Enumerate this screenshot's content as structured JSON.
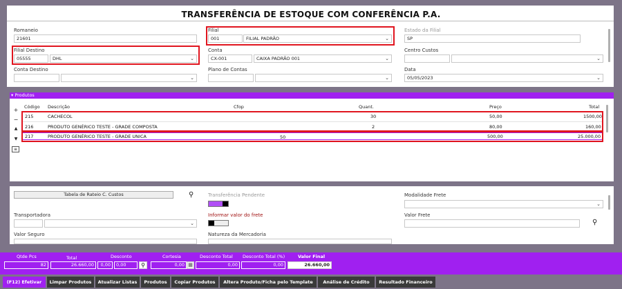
{
  "title": "TRANSFERÊNCIA DE ESTOQUE COM CONFERÊNCIA P.A.",
  "header": {
    "romaneio_label": "Romaneio",
    "romaneio_value": "21601",
    "filial_label": "Filial",
    "filial_code": "001",
    "filial_name": "FILIAL PADRÃO",
    "estado_label": "Estado da Filial",
    "estado_value": "SP",
    "filial_destino_label": "Filial Destino",
    "filial_destino_code": "05555",
    "filial_destino_name": "DHL",
    "conta_label": "Conta",
    "conta_code": "CX-001",
    "conta_name": "CAIXA PADRÃO 001",
    "centro_custos_label": "Centro Custos",
    "conta_destino_label": "Conta Destino",
    "plano_contas_label": "Plano de Contas",
    "data_label": "Data",
    "data_value": "05/05/2023"
  },
  "produtos": {
    "section_label": "Produtos",
    "columns": [
      "Código",
      "Descrição",
      "Cfop",
      "Quant.",
      "Preço",
      "Total"
    ],
    "rows": [
      {
        "codigo": "215",
        "descricao": "CACHECOL",
        "cfop": "",
        "quant": "30",
        "preco": "50,00",
        "total": "1500,00"
      },
      {
        "codigo": "216",
        "descricao": "PRODUTO GENÉRICO TESTE - GRADE COMPOSTA",
        "cfop": "",
        "quant": "2",
        "preco": "80,00",
        "total": "160,00"
      },
      {
        "codigo": "217",
        "descricao": "PRODUTO GENÉRICO TESTE - GRADE UNICA",
        "cfop": "",
        "quant": "50",
        "preco": "500,00",
        "total": "25.000,00"
      }
    ]
  },
  "lower": {
    "rateio_button": "Tabela de Rateio C. Custos",
    "transferencia_pendente_label": "Transferência Pendente",
    "modalidade_frete_label": "Modalidade Frete",
    "transportadora_label": "Transportadora",
    "informar_frete_label": "Informar valor do frete",
    "valor_frete_label": "Valor Frete",
    "valor_seguro_label": "Valor Seguro",
    "natureza_label": "Natureza da Mercadoria"
  },
  "totals": {
    "qtde_pcs_label": "Qtde Pcs",
    "qtde_pcs": "82",
    "total_label": "Total",
    "total": "26.660,00",
    "desconto_label": "Desconto",
    "desconto_1": "0,00",
    "desconto_2": "0,00",
    "cortesia_label": "Cortesia",
    "cortesia": "0,00",
    "desconto_total_label": "Desconto Total",
    "desconto_total": "0,00",
    "desconto_total_pct_label": "Desconto Total (%)",
    "desconto_total_pct": "0,00",
    "valor_final_label": "Valor Final",
    "valor_final": "26.660,00"
  },
  "tabs": [
    "(F12) Efetivar",
    "Limpar Produtos",
    "Atualizar Listas",
    "Produtos",
    "Copiar Produtos",
    "Altera Produto/Ficha pelo Template",
    "Análise de Crédito",
    "Resultado Financeiro"
  ],
  "colors": {
    "accent": "#a020f0",
    "highlight": "#e0141e",
    "background": "#7d7488"
  }
}
